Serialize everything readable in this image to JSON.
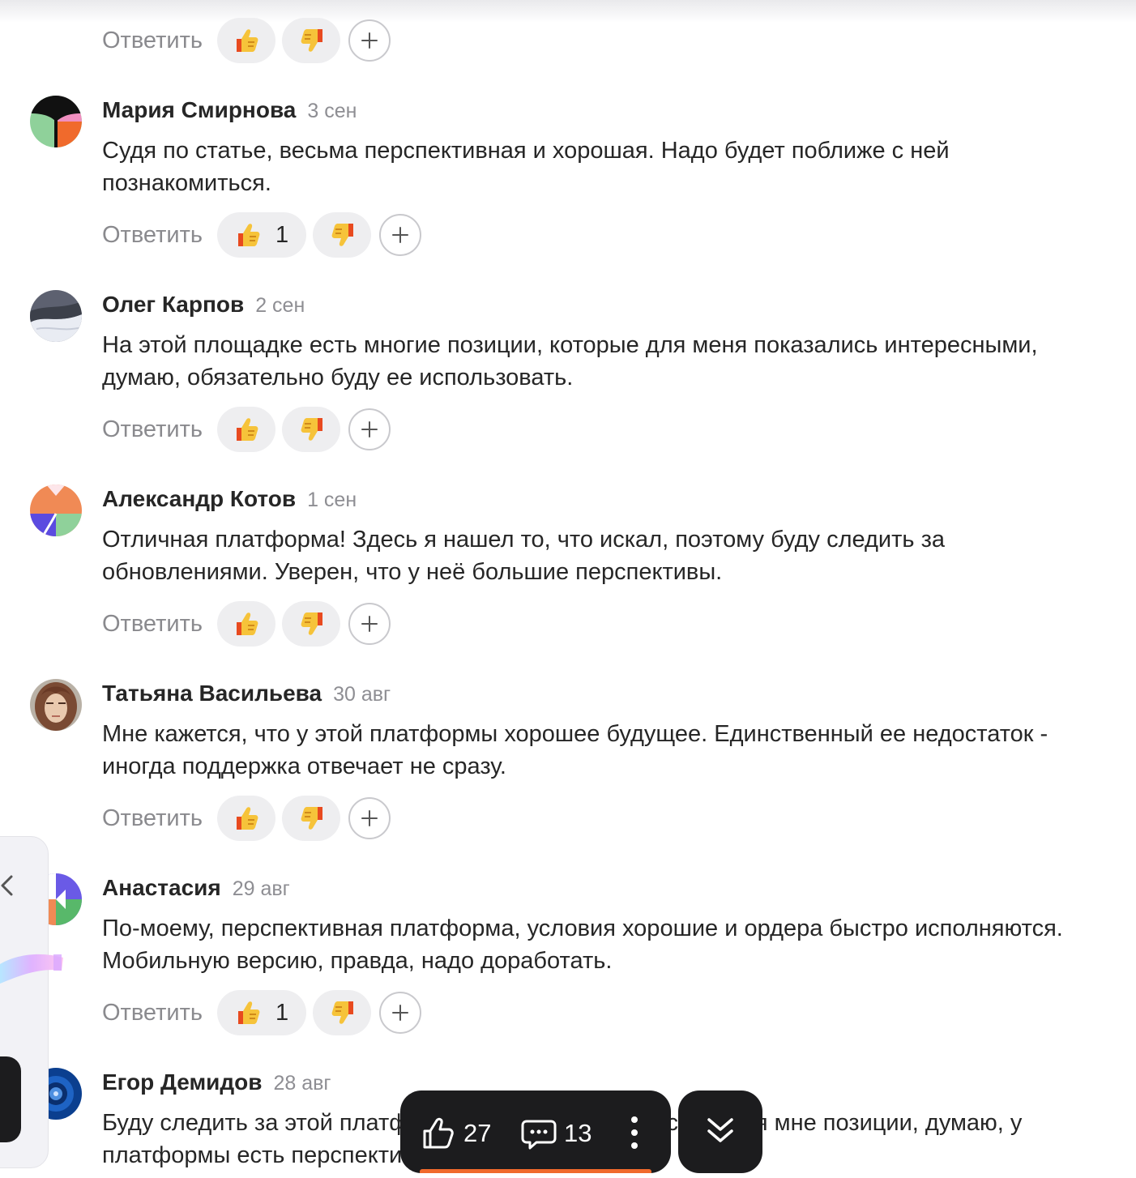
{
  "previous_comment_tail": "…",
  "reply_label": "Ответить",
  "comments": [
    {
      "author": "",
      "date": "",
      "text": "",
      "likes": ""
    },
    {
      "author": "Мария Смирнова",
      "date": "3 сен",
      "text": "Судя по статье, весьма перспективная и хорошая. Надо будет поближе с ней познакомиться.",
      "likes": "1"
    },
    {
      "author": "Олег Карпов",
      "date": "2 сен",
      "text": "На этой площадке есть многие позиции, которые для меня показались интересными, думаю, обязательно буду ее использовать.",
      "likes": ""
    },
    {
      "author": "Александр Котов",
      "date": "1 сен",
      "text": "Отличная платформа! Здесь я нашел то, что искал, поэтому буду следить за обновлениями. Уверен, что у неё большие перспективы.",
      "likes": ""
    },
    {
      "author": "Татьяна Васильева",
      "date": "30 авг",
      "text": "Мне кажется, что у этой платформы хорошее будущее. Единственный ее недостаток - иногда поддержка отвечает не сразу.",
      "likes": ""
    },
    {
      "author": "Анастасия",
      "date": "29 авг",
      "text": "По-моему, перспективная платформа, условия хорошие и ордера быстро исполняются. Мобильную версию, правда, надо доработать.",
      "likes": "1"
    },
    {
      "author": "Егор Демидов",
      "date": "28 авг",
      "text": "Буду следить за этой платформой, там есть интересные для мне позиции, думаю, у платформы есть перспективы.",
      "likes": ""
    }
  ],
  "toolbar": {
    "likes": "27",
    "comments": "13"
  },
  "icons": {
    "like": "thumbs-up-emoji",
    "dislike": "thumbs-down-emoji",
    "add": "plus-icon",
    "toolbar_like": "thumbs-up-outline-icon",
    "toolbar_comment": "comment-bubble-icon",
    "more": "more-vertical-icon",
    "scroll": "double-chevron-down-icon"
  },
  "colors": {
    "accent": "#f06a2c",
    "toolbar_bg": "#1c1c1e",
    "reaction_bg": "#eeeef0",
    "muted_text": "#8a8a8e"
  }
}
